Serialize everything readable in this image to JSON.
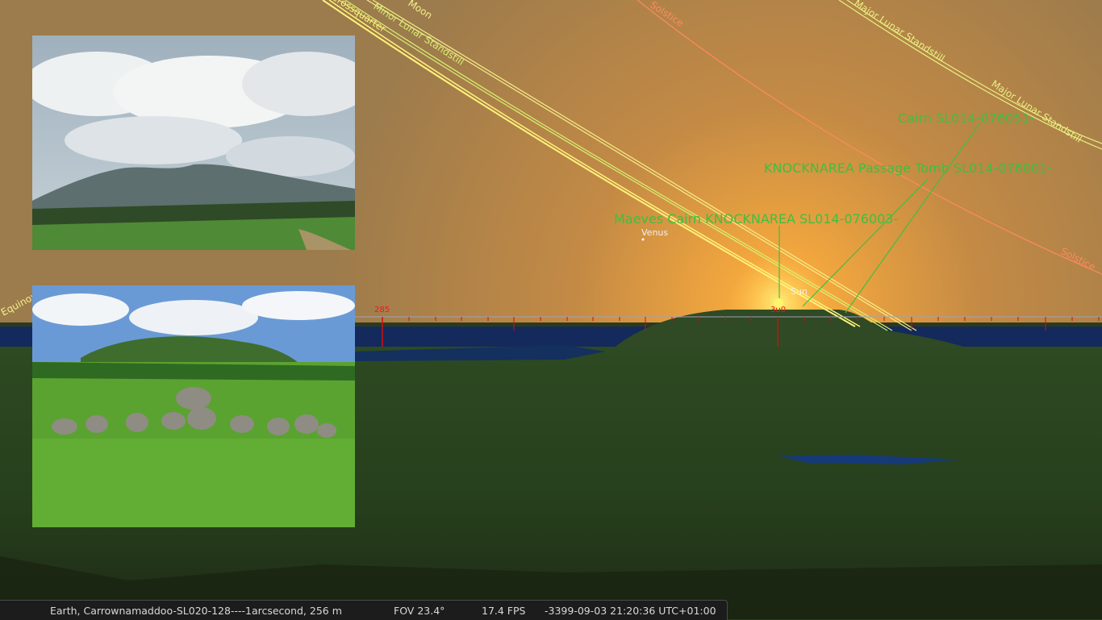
{
  "sky_labels": {
    "moon": "Moon",
    "crossquarter": "Crossquarter",
    "minor_lunar": "Minor Lunar Standstill",
    "solstice_top": "Solstice",
    "major_lunar_top": "Major Lunar Standstill",
    "major_lunar_right": "Major Lunar Standstill",
    "solstice_right": "Solstice",
    "equinox": "Equinox"
  },
  "landmarks": {
    "cairn": "Cairn SL014-076051-",
    "passage_tomb": "KNOCKNAREA Passage Tomb SL014-076001-",
    "maeves_cairn": "Maeves Cairn KNOCKNAREA SL014-076003-"
  },
  "objects": {
    "venus": "Venus",
    "sun": "Sun"
  },
  "azimuth": {
    "tick_285": "285",
    "tick_300": "300"
  },
  "status": {
    "location": "Earth, Carrownamaddoo-SL020-128----1arcsecond, 256 m",
    "fov": "FOV 23.4°",
    "fps": "17.4 FPS",
    "datetime": "-3399-09-03 21:20:36 UTC+01:00"
  },
  "colors": {
    "landmark_label": "#3fbf3f",
    "azimuth_grid": "#d01010",
    "solstice_line": "#ff8a5c",
    "lunar_line": "#e8f080",
    "crossquarter_line": "#fff27a",
    "status_bg": "#1c1c1c"
  }
}
